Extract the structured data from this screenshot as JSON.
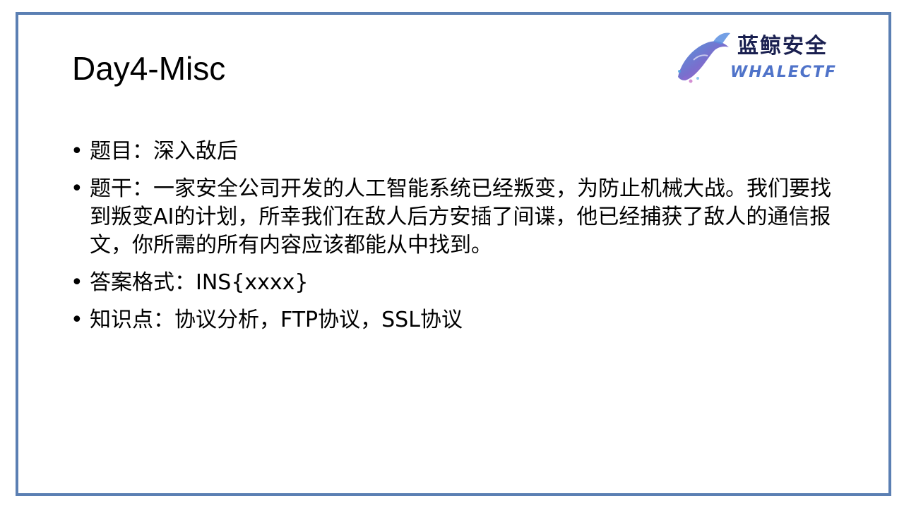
{
  "slide": {
    "title": "Day4-Misc",
    "logo": {
      "name_cn": "蓝鲸安全",
      "name_en": "WHALECTF"
    },
    "bullets": [
      {
        "marker": "•",
        "text": "题目：深入敌后"
      },
      {
        "marker": "•",
        "text": "题干：一家安全公司开发的人工智能系统已经叛变，为防止机械大战。我们要找到叛变AI的计划，所幸我们在敌人后方安插了间谍，他已经捕获了敌人的通信报文，你所需的所有内容应该都能从中找到。"
      },
      {
        "marker": "•",
        "text": "答案格式：INS{xxxx}"
      },
      {
        "marker": "•",
        "text": "知识点：协议分析，FTP协议，SSL协议"
      }
    ]
  },
  "colors": {
    "frame_border": "#5b7fb3",
    "logo_cn": "#1a2050",
    "logo_en": "#4f73c9"
  }
}
